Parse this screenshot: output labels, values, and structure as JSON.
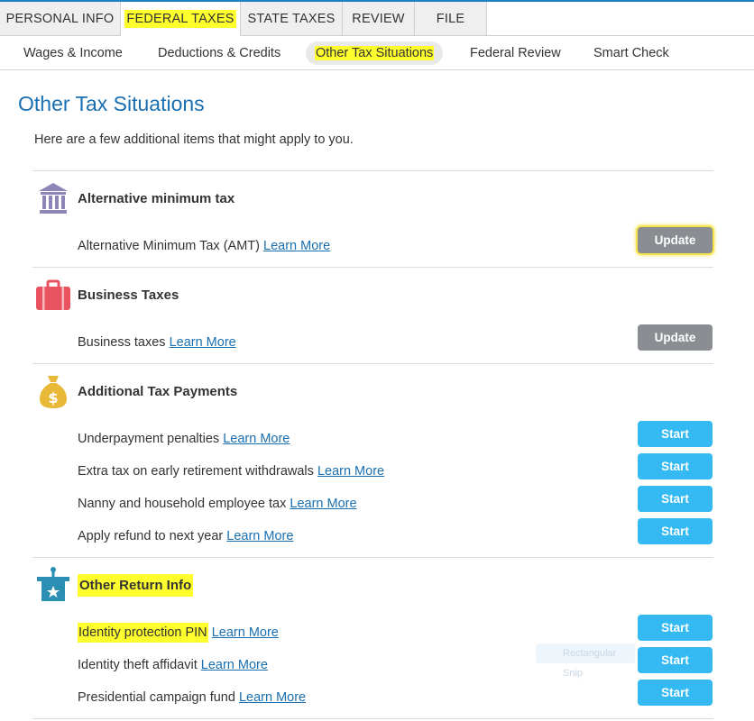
{
  "top_tabs": [
    {
      "label": "PERSONAL INFO"
    },
    {
      "label": "FEDERAL TAXES"
    },
    {
      "label": "STATE TAXES"
    },
    {
      "label": "REVIEW"
    },
    {
      "label": "FILE"
    }
  ],
  "sub_nav": [
    {
      "label": "Wages & Income"
    },
    {
      "label": "Deductions & Credits"
    },
    {
      "label": "Other Tax Situations"
    },
    {
      "label": "Federal Review"
    },
    {
      "label": "Smart Check"
    }
  ],
  "page": {
    "title": "Other Tax Situations",
    "intro": "Here are a few additional items that might apply to you.",
    "learn_more": "Learn More"
  },
  "sections": [
    {
      "title": "Alternative minimum tax",
      "icon": "bank-icon",
      "rows": [
        {
          "label": "Alternative Minimum Tax (AMT)",
          "button": "Update"
        }
      ]
    },
    {
      "title": "Business Taxes",
      "icon": "briefcase-icon",
      "rows": [
        {
          "label": "Business taxes",
          "button": "Update"
        }
      ]
    },
    {
      "title": "Additional Tax Payments",
      "icon": "money-bag-icon",
      "rows": [
        {
          "label": "Underpayment penalties",
          "button": "Start"
        },
        {
          "label": "Extra tax on early retirement withdrawals",
          "button": "Start"
        },
        {
          "label": "Nanny and household employee tax",
          "button": "Start"
        },
        {
          "label": "Apply refund to next year",
          "button": "Start"
        }
      ]
    },
    {
      "title": "Other Return Info",
      "icon": "ballot-box-icon",
      "rows": [
        {
          "label": "Identity protection PIN",
          "button": "Start"
        },
        {
          "label": "Identity theft affidavit",
          "button": "Start"
        },
        {
          "label": "Presidential campaign fund",
          "button": "Start"
        }
      ]
    }
  ],
  "ghost_tooltip": "Rectangular Snip",
  "colors": {
    "accent_blue": "#1a6fb0",
    "start_button": "#35b9f2",
    "update_button": "#8a8d91",
    "highlight": "#ffff2e"
  }
}
